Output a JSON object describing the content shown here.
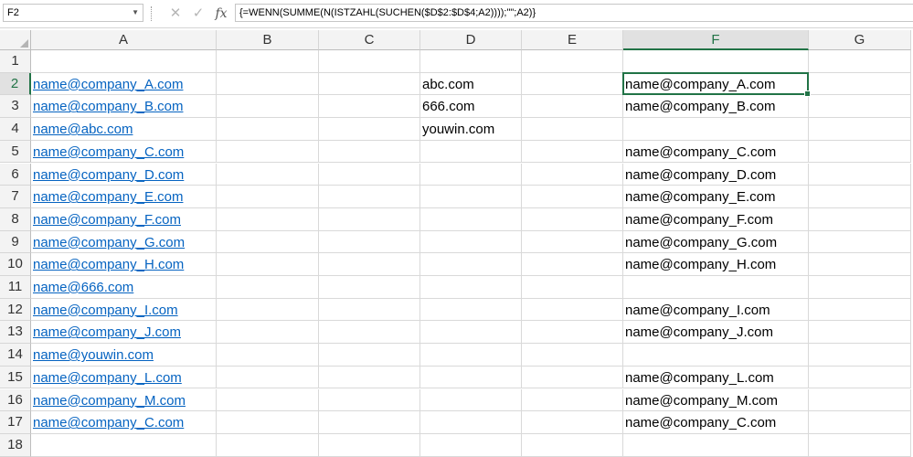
{
  "formula_bar": {
    "name_box": "F2",
    "cancel_icon": "close-icon",
    "enter_icon": "check-icon",
    "function_icon": "fx",
    "formula": "{=WENN(SUMME(N(ISTZAHL(SUCHEN($D$2:$D$4;A2))));\"\";A2)}"
  },
  "columns": [
    "A",
    "B",
    "C",
    "D",
    "E",
    "F",
    "G"
  ],
  "rows": [
    "1",
    "2",
    "3",
    "4",
    "5",
    "6",
    "7",
    "8",
    "9",
    "10",
    "11",
    "12",
    "13",
    "14",
    "15",
    "16",
    "17",
    "18"
  ],
  "active_cell": "F2",
  "colors": {
    "accent": "#217346",
    "hyperlink": "#0563c1"
  },
  "cells": {
    "A2": "name@company_A.com",
    "A3": "name@company_B.com",
    "A4": "name@abc.com",
    "A5": "name@company_C.com",
    "A6": "name@company_D.com",
    "A7": "name@company_E.com",
    "A8": "name@company_F.com",
    "A9": "name@company_G.com",
    "A10": "name@company_H.com",
    "A11": "name@666.com",
    "A12": "name@company_I.com",
    "A13": "name@company_J.com",
    "A14": "name@youwin.com",
    "A15": "name@company_L.com",
    "A16": "name@company_M.com",
    "A17": "name@company_C.com",
    "D2": "abc.com",
    "D3": "666.com",
    "D4": "youwin.com",
    "F2": "name@company_A.com",
    "F3": "name@company_B.com",
    "F5": "name@company_C.com",
    "F6": "name@company_D.com",
    "F7": "name@company_E.com",
    "F8": "name@company_F.com",
    "F9": "name@company_G.com",
    "F10": "name@company_H.com",
    "F12": "name@company_I.com",
    "F13": "name@company_J.com",
    "F15": "name@company_L.com",
    "F16": "name@company_M.com",
    "F17": "name@company_C.com"
  }
}
